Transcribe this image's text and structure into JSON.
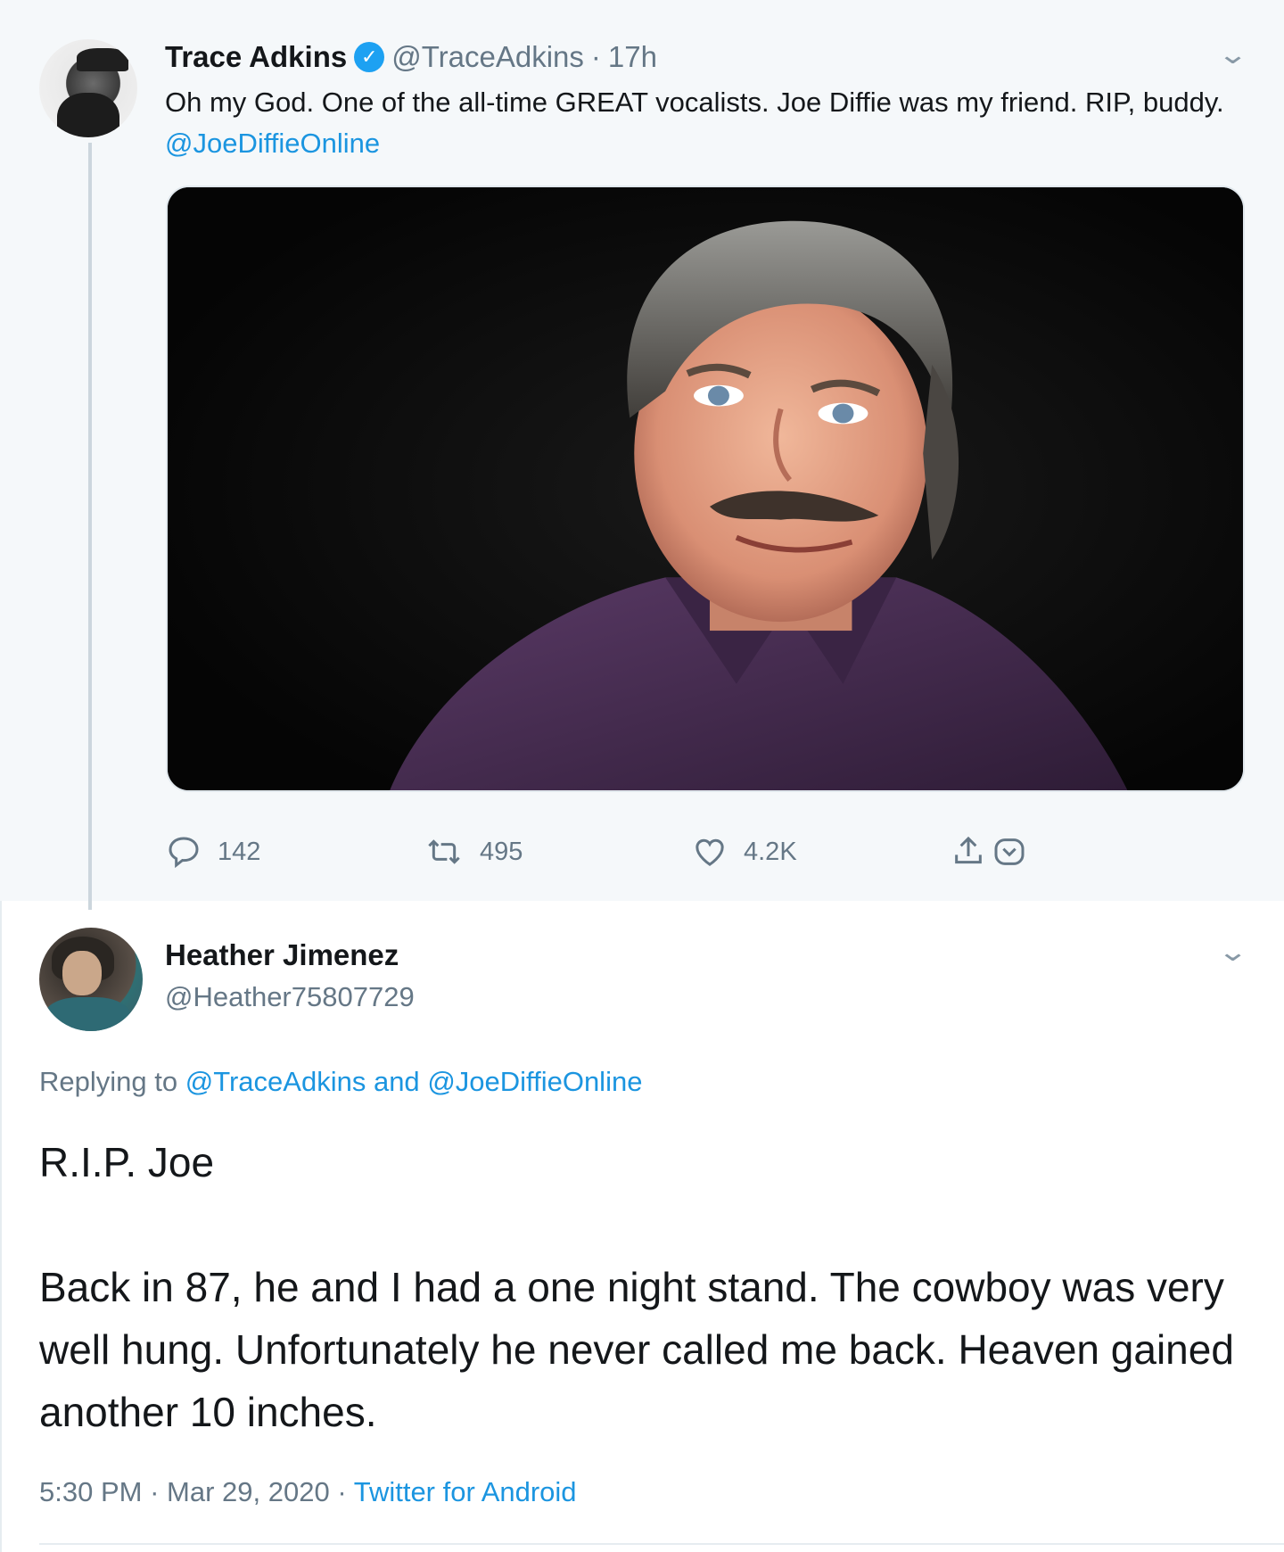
{
  "tweet": {
    "author_name": "Trace Adkins",
    "verified_mark": "✓",
    "handle": "@TraceAdkins",
    "separator": "·",
    "time": "17h",
    "text": "Oh my God. One of the all-time GREAT vocalists. Joe Diffie was my friend. RIP, buddy.",
    "mention": "@JoeDiffieOnline",
    "image_icon": "portrait-photo",
    "actions": {
      "replies": "142",
      "retweets": "495",
      "likes": "4.2K"
    }
  },
  "reply": {
    "author_name": "Heather Jimenez",
    "handle": "@Heather75807729",
    "replying_prefix": "Replying to",
    "replying_to_1": "@TraceAdkins",
    "replying_and": "and",
    "replying_to_2": "@JoeDiffieOnline",
    "body": "R.I.P. Joe\n\nBack in 87, he and I had a one night stand.  The cowboy was very well hung.  Unfortunately he never called me back.  Heaven gained another 10 inches.",
    "time": "5:30 PM",
    "separator": "·",
    "date": "Mar 29, 2020",
    "source": "Twitter for Android"
  },
  "colors": {
    "link": "#1b95e0",
    "muted": "#657786",
    "verified": "#1da1f2",
    "text": "#14171a"
  }
}
